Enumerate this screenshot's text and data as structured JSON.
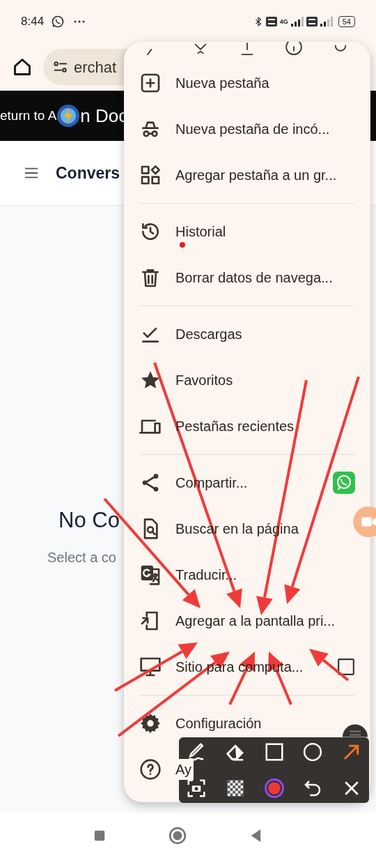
{
  "status_bar": {
    "time": "8:44",
    "battery": "54",
    "network": "4G"
  },
  "toolbar": {
    "address": "erchat"
  },
  "banner": {
    "text_left": "eturn to A",
    "text_right": "n Doc"
  },
  "header": {
    "title": "Convers"
  },
  "empty_state": {
    "title": "No Co",
    "subtitle": "Select a co"
  },
  "menu": {
    "sections": [
      [
        {
          "label": "Nueva pestaña",
          "kind": "plain",
          "dot": false
        },
        {
          "label": "Nueva pestaña de incó...",
          "kind": "plain",
          "dot": false
        },
        {
          "label": "Agregar pestaña a un gr...",
          "kind": "plain",
          "dot": false
        }
      ],
      [
        {
          "label": "Historial",
          "kind": "plain",
          "dot": true
        },
        {
          "label": "Borrar datos de navega...",
          "kind": "plain",
          "dot": false
        }
      ],
      [
        {
          "label": "Descargas",
          "kind": "plain",
          "dot": false
        },
        {
          "label": "Favoritos",
          "kind": "plain",
          "dot": false
        },
        {
          "label": "Pestañas recientes",
          "kind": "plain",
          "dot": false
        }
      ],
      [
        {
          "label": "Compartir...",
          "kind": "share",
          "dot": false
        },
        {
          "label": "Buscar en la página",
          "kind": "plain",
          "dot": false
        },
        {
          "label": "Traducir...",
          "kind": "plain",
          "dot": false
        },
        {
          "label": "Agregar a la pantalla pri...",
          "kind": "plain",
          "dot": false
        },
        {
          "label": "Sitio para computa...",
          "kind": "checkbox",
          "checked": false,
          "dot": false
        }
      ],
      [
        {
          "label": "Configuración",
          "kind": "plain",
          "dot": false
        },
        {
          "label": "Ay",
          "kind": "plain",
          "dot": false
        }
      ]
    ]
  },
  "annotation_tools": [
    {
      "selected": false
    },
    {
      "selected": false
    },
    {
      "selected": false
    },
    {
      "selected": false
    },
    {
      "selected": true
    }
  ]
}
